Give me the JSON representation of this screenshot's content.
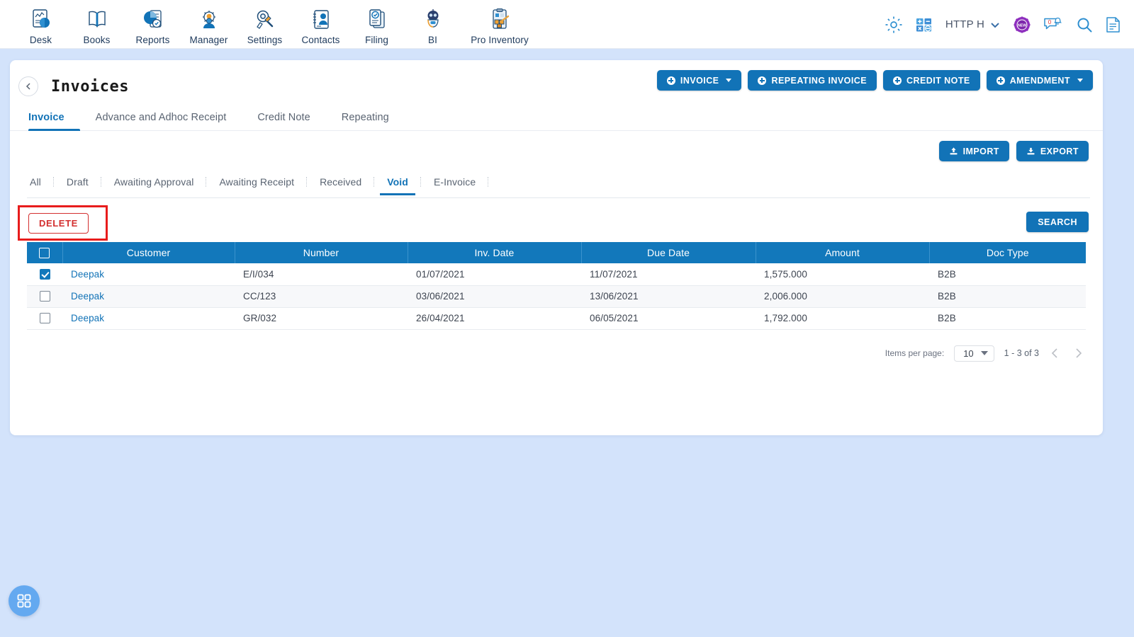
{
  "topnav": {
    "apps": [
      {
        "label": "Desk",
        "icon": "desk-icon"
      },
      {
        "label": "Books",
        "icon": "books-icon"
      },
      {
        "label": "Reports",
        "icon": "reports-icon"
      },
      {
        "label": "Manager",
        "icon": "manager-icon"
      },
      {
        "label": "Settings",
        "icon": "settings-icon"
      },
      {
        "label": "Contacts",
        "icon": "contacts-icon"
      },
      {
        "label": "Filing",
        "icon": "filing-icon"
      },
      {
        "label": "BI",
        "icon": "bi-robot-icon"
      },
      {
        "label": "Pro Inventory",
        "icon": "pro-inventory-icon"
      }
    ],
    "user": "HTTP H",
    "badge_new": "NEW",
    "notification_count": "0",
    "icons": [
      "gear-icon",
      "calculator-icon",
      "new-badge-icon",
      "notification-icon",
      "search-icon",
      "document-icon"
    ]
  },
  "page": {
    "title": "Invoices",
    "back_icon": "chevron-left-icon"
  },
  "head_actions": [
    {
      "label": "INVOICE",
      "caret": true
    },
    {
      "label": "REPEATING INVOICE",
      "caret": false
    },
    {
      "label": "CREDIT NOTE",
      "caret": false
    },
    {
      "label": "AMENDMENT",
      "caret": true
    }
  ],
  "tabs": [
    {
      "label": "Invoice",
      "active": true
    },
    {
      "label": "Advance and Adhoc Receipt",
      "active": false
    },
    {
      "label": "Credit Note",
      "active": false
    },
    {
      "label": "Repeating",
      "active": false
    }
  ],
  "io_buttons": {
    "import": "IMPORT",
    "export": "EXPORT"
  },
  "subtabs": [
    {
      "label": "All",
      "active": false
    },
    {
      "label": "Draft",
      "active": false
    },
    {
      "label": "Awaiting Approval",
      "active": false
    },
    {
      "label": "Awaiting Receipt",
      "active": false
    },
    {
      "label": "Received",
      "active": false
    },
    {
      "label": "Void",
      "active": true
    },
    {
      "label": "E-Invoice",
      "active": false
    }
  ],
  "actions": {
    "delete": "DELETE",
    "search": "SEARCH"
  },
  "table": {
    "columns": [
      "Customer",
      "Number",
      "Inv. Date",
      "Due Date",
      "Amount",
      "Doc Type"
    ],
    "header_checkbox_checked": false,
    "rows": [
      {
        "checked": true,
        "customer": "Deepak",
        "number": "E/I/034",
        "inv_date": "01/07/2021",
        "due_date": "11/07/2021",
        "amount": "1,575.000",
        "doc_type": "B2B"
      },
      {
        "checked": false,
        "customer": "Deepak",
        "number": "CC/123",
        "inv_date": "03/06/2021",
        "due_date": "13/06/2021",
        "amount": "2,006.000",
        "doc_type": "B2B"
      },
      {
        "checked": false,
        "customer": "Deepak",
        "number": "GR/032",
        "inv_date": "26/04/2021",
        "due_date": "06/05/2021",
        "amount": "1,792.000",
        "doc_type": "B2B"
      }
    ]
  },
  "paginator": {
    "items_per_page_label": "Items per page:",
    "items_per_page_value": "10",
    "range": "1 - 3 of 3"
  },
  "fab": {
    "icon": "grid-apps-icon"
  },
  "colors": {
    "accent": "#1273b7",
    "page_bg": "#d3e3fb",
    "danger": "#d32f2f",
    "highlight": "#e81c1c"
  }
}
